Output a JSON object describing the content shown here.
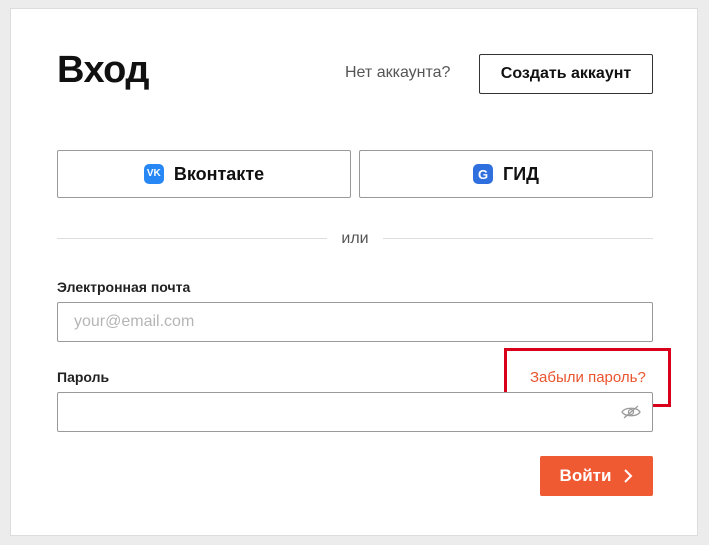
{
  "header": {
    "title": "Вход",
    "no_account_text": "Нет аккаунта?",
    "create_account_label": "Создать аккаунт"
  },
  "social": {
    "vk": {
      "label": "Вконтакте",
      "icon": "vk-icon",
      "icon_text": "VK",
      "color": "#2787f5"
    },
    "gid": {
      "label": "ГИД",
      "icon": "gid-icon",
      "icon_text": "G",
      "color": "#2f6fde"
    }
  },
  "divider_text": "или",
  "form": {
    "email": {
      "label": "Электронная почта",
      "placeholder": "your@email.com",
      "value": ""
    },
    "password": {
      "label": "Пароль",
      "value": "",
      "visibility_icon": "eye-off-icon"
    },
    "forgot_password_label": "Забыли пароль?",
    "submit_label": "Войти",
    "submit_icon": "chevron-right-icon"
  },
  "colors": {
    "accent": "#f05a33",
    "link": "#e8552f",
    "highlight": "#d9001b",
    "background": "#ececec"
  }
}
